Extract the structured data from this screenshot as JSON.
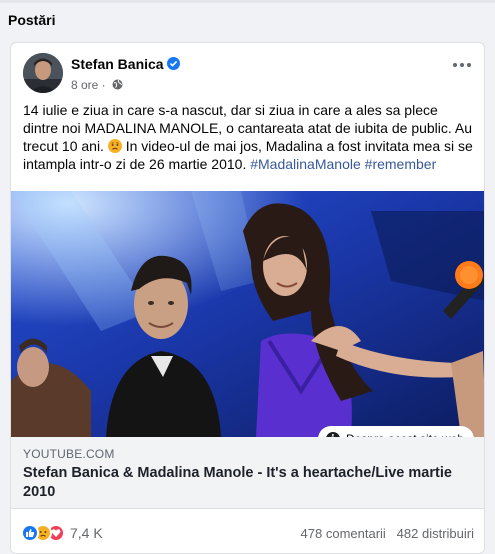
{
  "section": {
    "title": "Postări"
  },
  "post": {
    "author": "Stefan Banica",
    "time": "8 ore ·",
    "text_main": "14 iulie e ziua in care s-a nascut, dar si ziua in care a ales sa plece dintre noi MADALINA MANOLE, o cantareata atat de iubita de public. Au trecut 10 ani.",
    "text_after": " In video-ul de mai jos, Madalina a fost invitata mea si se intampla intr-o zi de 26 martie 2010. ",
    "hashtag1": "#MadalinaManole",
    "hashtag2": "#remember",
    "emoji": "sad-face-emoji"
  },
  "link_preview": {
    "about_site": "Despre acest site web",
    "domain": "YOUTUBE.COM",
    "title": "Stefan Banica & Madalina Manole - It's a heartache/Live martie 2010"
  },
  "footer": {
    "reactions_count": "7,4 K",
    "comments": "478 comentarii",
    "shares": "482 distribuiri"
  },
  "colors": {
    "link_blue": "#385898",
    "verified_blue": "#1877f2",
    "muted_text": "#65676b",
    "stage_blue": "#1c3aa0"
  }
}
